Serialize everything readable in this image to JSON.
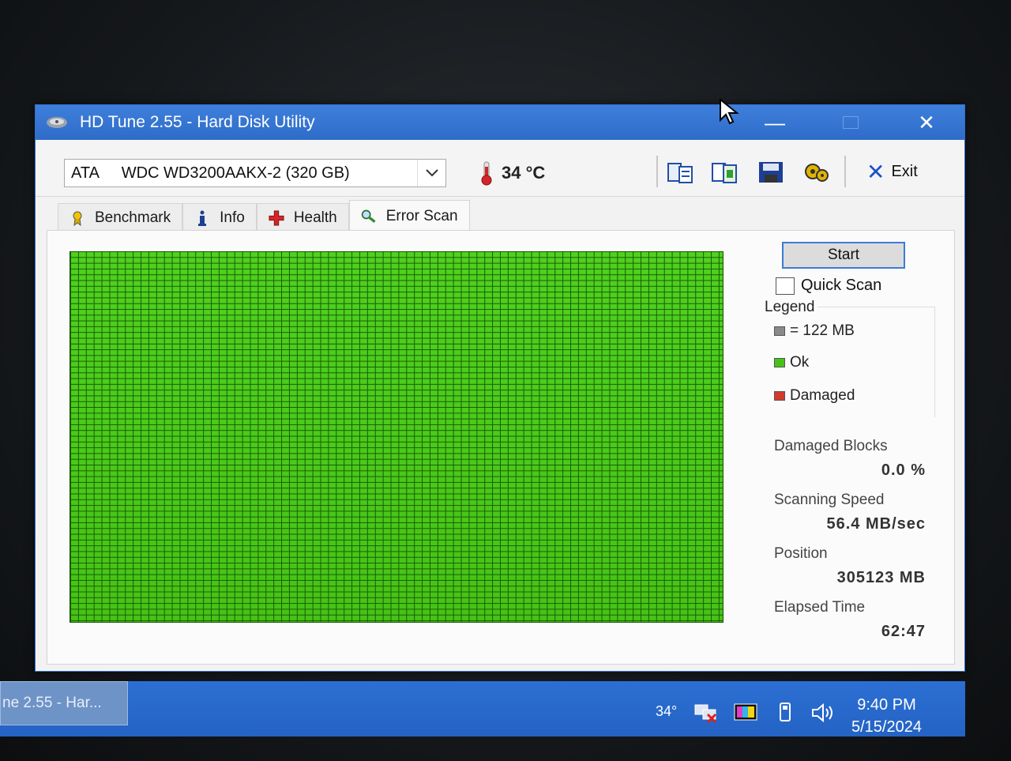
{
  "window": {
    "title": "HD Tune 2.55 - Hard Disk Utility",
    "minimize_label": "—",
    "close_label": "✕"
  },
  "toolbar": {
    "drive_interface": "ATA",
    "drive_name": "WDC WD3200AAKX-2 (320 GB)",
    "temperature": "34 °C",
    "exit_label": "Exit"
  },
  "tabs": [
    {
      "label": "Benchmark",
      "icon": "medal-icon",
      "active": false
    },
    {
      "label": "Info",
      "icon": "info-icon",
      "active": false
    },
    {
      "label": "Health",
      "icon": "health-cross-icon",
      "active": false
    },
    {
      "label": "Error Scan",
      "icon": "magnifier-icon",
      "active": true
    }
  ],
  "error_scan": {
    "start_label": "Start",
    "quick_scan_label": "Quick Scan",
    "quick_scan_checked": false,
    "legend": {
      "title": "Legend",
      "block_size": "= 122 MB",
      "ok_label": "Ok",
      "damaged_label": "Damaged"
    },
    "stats": {
      "damaged_blocks_label": "Damaged Blocks",
      "damaged_blocks_value": "0.0 %",
      "scanning_speed_label": "Scanning Speed",
      "scanning_speed_value": "56.4 MB/sec",
      "position_label": "Position",
      "position_value": "305123 MB",
      "elapsed_time_label": "Elapsed Time",
      "elapsed_time_value": "62:47"
    },
    "colors": {
      "ok": "#46c316",
      "damaged": "#d33a2c",
      "block": "#8a8a8a"
    }
  },
  "taskbar": {
    "task_label": "ne 2.55 - Har...",
    "tray_temp": "34°",
    "time": "9:40 PM",
    "date": "5/15/2024"
  }
}
